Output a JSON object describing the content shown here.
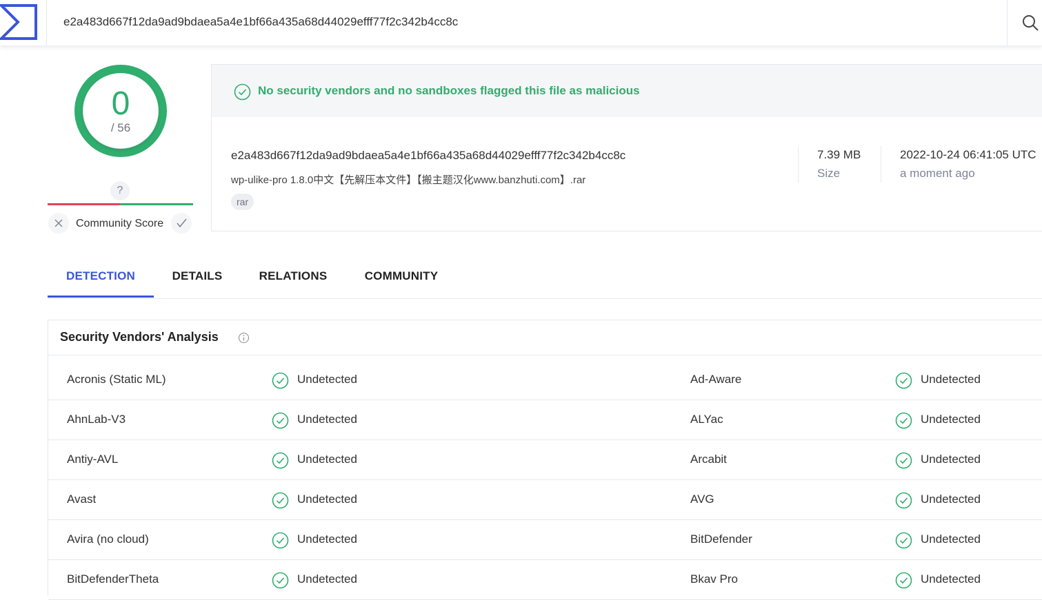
{
  "search": {
    "value": "e2a483d667f12da9ad9bdaea5a4e1bf66a435a68d44029efff77f2c342b4cc8c"
  },
  "score": {
    "detections": "0",
    "total": "/ 56"
  },
  "community": {
    "question": "?",
    "label": "Community Score"
  },
  "summary": {
    "verdict": "No security vendors and no sandboxes flagged this file as malicious",
    "hash": "e2a483d667f12da9ad9bdaea5a4e1bf66a435a68d44029efff77f2c342b4cc8c",
    "filename": "wp-ulike-pro 1.8.0中文【先解压本文件】【搬主题汉化www.banzhuti.com】.rar",
    "tag": "rar",
    "size_value": "7.39 MB",
    "size_label": "Size",
    "date_value": "2022-10-24 06:41:05 UTC",
    "date_label": "a moment ago"
  },
  "tabs": [
    "DETECTION",
    "DETAILS",
    "RELATIONS",
    "COMMUNITY"
  ],
  "analysis": {
    "title": "Security Vendors' Analysis",
    "rows": [
      {
        "left_vendor": "Acronis (Static ML)",
        "left_result": "Undetected",
        "right_vendor": "Ad-Aware",
        "right_result": "Undetected"
      },
      {
        "left_vendor": "AhnLab-V3",
        "left_result": "Undetected",
        "right_vendor": "ALYac",
        "right_result": "Undetected"
      },
      {
        "left_vendor": "Antiy-AVL",
        "left_result": "Undetected",
        "right_vendor": "Arcabit",
        "right_result": "Undetected"
      },
      {
        "left_vendor": "Avast",
        "left_result": "Undetected",
        "right_vendor": "AVG",
        "right_result": "Undetected"
      },
      {
        "left_vendor": "Avira (no cloud)",
        "left_result": "Undetected",
        "right_vendor": "BitDefender",
        "right_result": "Undetected"
      },
      {
        "left_vendor": "BitDefenderTheta",
        "left_result": "Undetected",
        "right_vendor": "Bkav Pro",
        "right_result": "Undetected"
      }
    ]
  },
  "colors": {
    "accent": "#3b55d9",
    "clean": "#2fae6e",
    "malicious": "#e2435a"
  },
  "icons": {
    "logo": "virustotal-sigma-logo",
    "search": "search-icon",
    "check": "check-circle-icon",
    "info": "info-icon"
  }
}
